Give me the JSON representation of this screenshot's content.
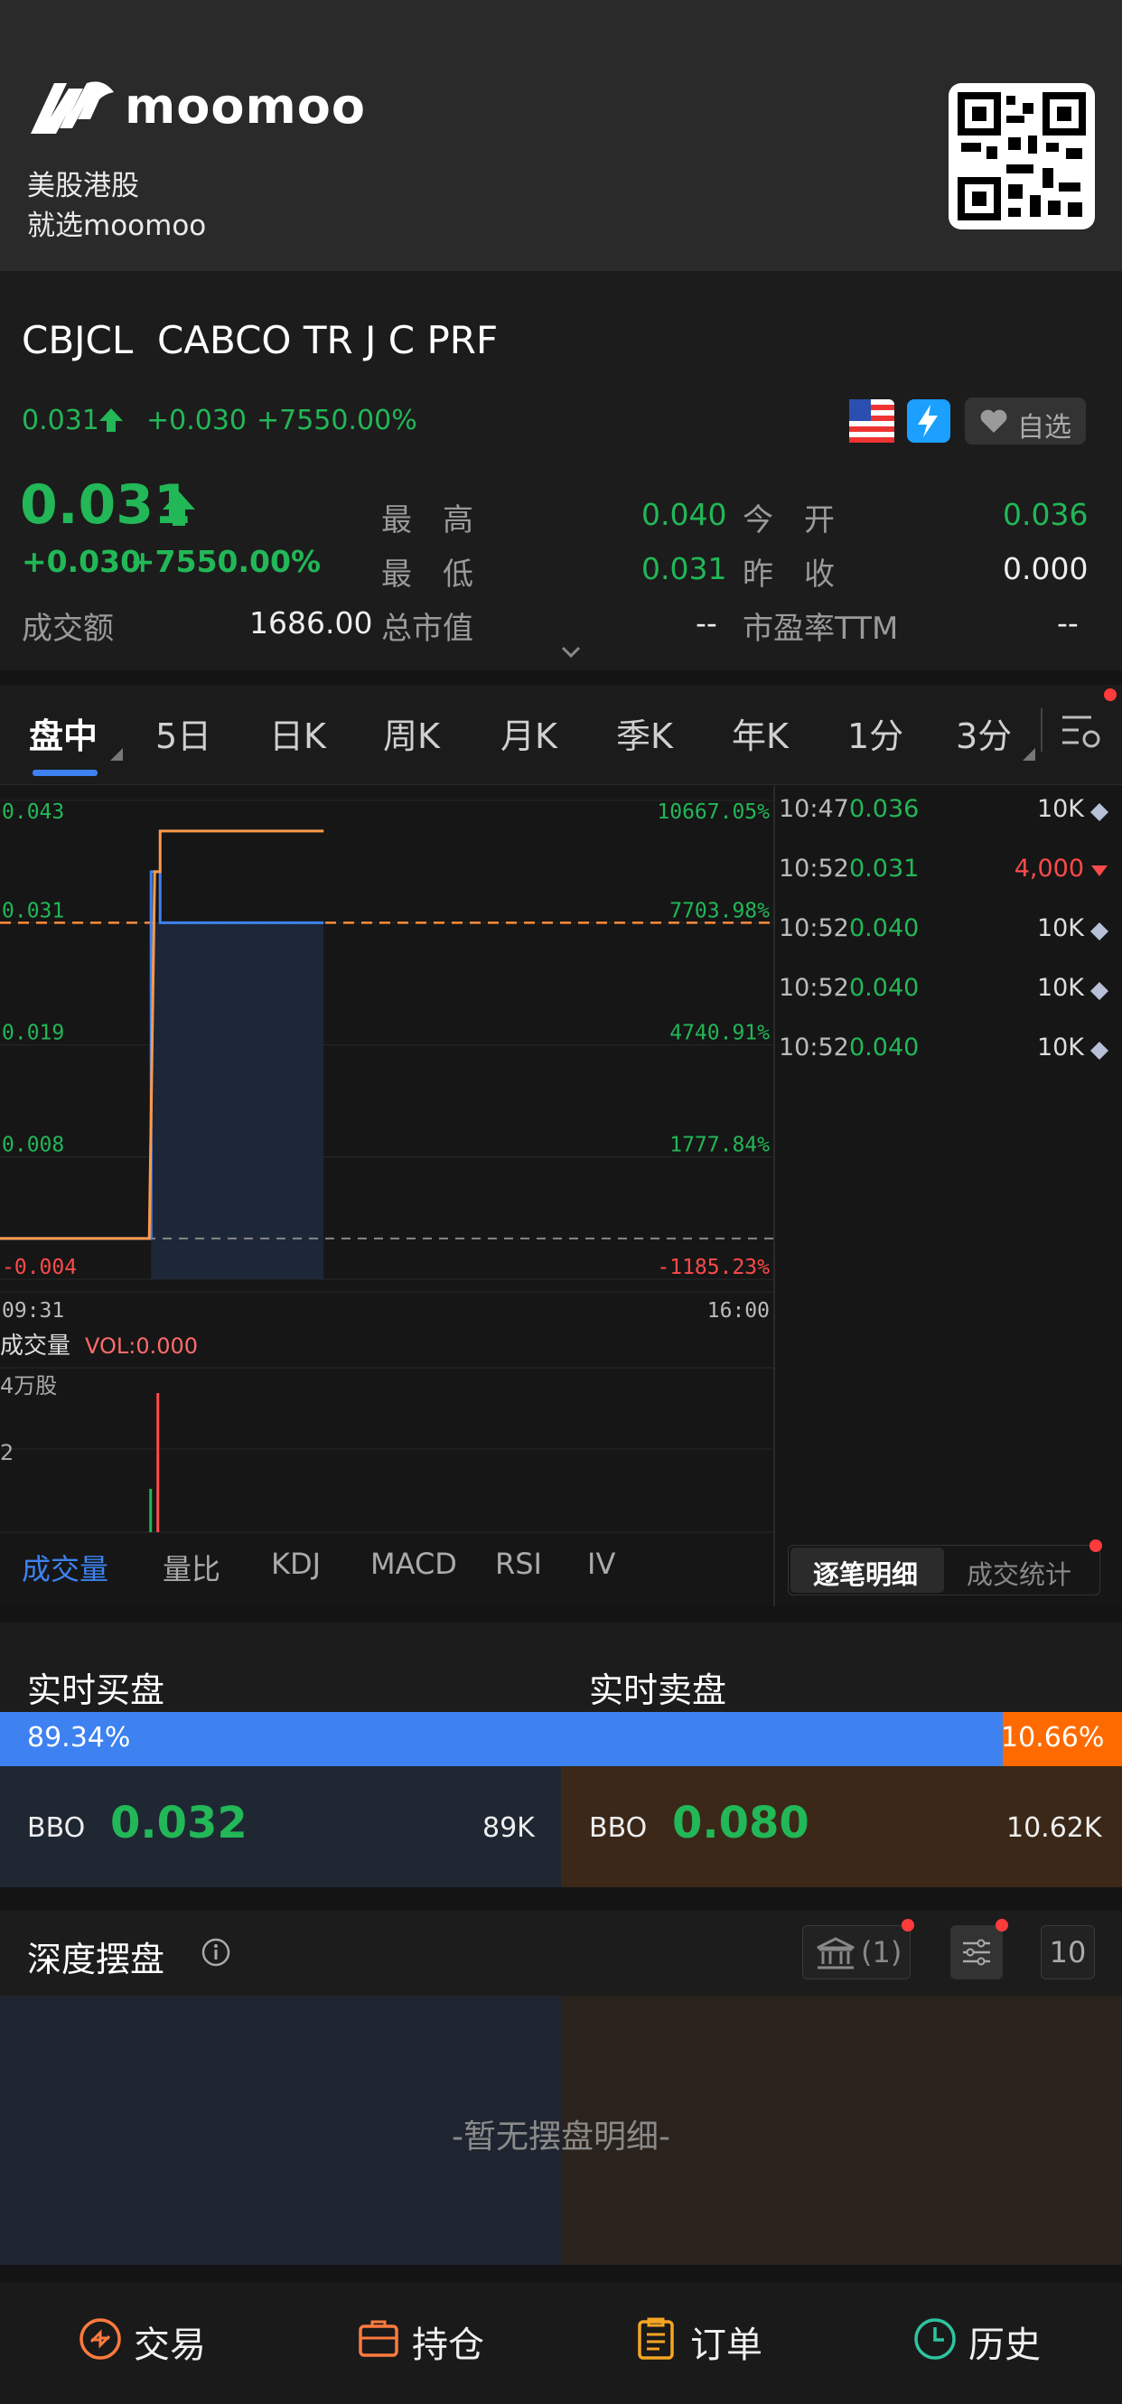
{
  "banner": {
    "brand": "moomoo",
    "slogan1": "美股港股",
    "slogan2": "就选moomoo"
  },
  "stock": {
    "code": "CBJCL",
    "name": "CABCO TR J C PRF",
    "mini_price": "0.031",
    "mini_change": "+0.030",
    "mini_pct": "+7550.00%",
    "watch_label": "自选",
    "price": "0.031",
    "change": "+0.030",
    "pct": "+7550.00%",
    "turnover_label": "成交额",
    "turnover": "1686.00",
    "high_label": "最　高",
    "high": "0.040",
    "low_label": "最　低",
    "low": "0.031",
    "mcap_label": "总市值",
    "mcap": "--",
    "open_label": "今　开",
    "open": "0.036",
    "prev_label": "昨　收",
    "prev": "0.000",
    "pe_label": "市盈率TTM",
    "pe": "--"
  },
  "tabs": [
    "盘中",
    "5日",
    "日K",
    "周K",
    "月K",
    "季K",
    "年K",
    "1分",
    "3分"
  ],
  "chart_data": {
    "type": "line",
    "title": "",
    "x": [
      "09:31",
      "10:47",
      "10:52",
      "16:00"
    ],
    "x_range": [
      "09:31",
      "16:00"
    ],
    "y_ticks_left": [
      "0.043",
      "0.031",
      "0.019",
      "0.008",
      "-0.004"
    ],
    "y_ticks_right": [
      "10667.05%",
      "7703.98%",
      "4740.91%",
      "1777.84%",
      "-1185.23%"
    ],
    "ylim": [
      -0.004,
      0.043
    ],
    "series": [
      {
        "values": [
          0.0,
          0.036,
          0.04
        ]
      },
      {
        "values": [
          0.0,
          0.036,
          0.031
        ]
      }
    ],
    "ref_line_price": 0.031,
    "prev_close": 0.0,
    "grid": true
  },
  "volume": {
    "label": "成交量",
    "vol": "VOL:0.000",
    "unit": "4万股",
    "tick": "2"
  },
  "indicators": [
    "成交量",
    "量比",
    "KDJ",
    "MACD",
    "RSI",
    "IV"
  ],
  "ticks": [
    {
      "time": "10:47",
      "price": "0.036",
      "vol": "10K",
      "dir": "neutral"
    },
    {
      "time": "10:52",
      "price": "0.031",
      "vol": "4,000",
      "dir": "down"
    },
    {
      "time": "10:52",
      "price": "0.040",
      "vol": "10K",
      "dir": "neutral"
    },
    {
      "time": "10:52",
      "price": "0.040",
      "vol": "10K",
      "dir": "neutral"
    },
    {
      "time": "10:52",
      "price": "0.040",
      "vol": "10K",
      "dir": "neutral"
    }
  ],
  "tick_tabs": [
    "逐笔明细",
    "成交统计"
  ],
  "orderbook": {
    "bid_title": "实时买盘",
    "ask_title": "实时卖盘",
    "bid_pct": "89.34%",
    "ask_pct": "10.66%",
    "bid_ratio": 0.8934,
    "bid_label": "BBO",
    "bid_price": "0.032",
    "bid_size": "89K",
    "ask_label": "BBO",
    "ask_price": "0.080",
    "ask_size": "10.62K"
  },
  "depth": {
    "title": "深度摆盘",
    "broker": "(1)",
    "levels": "10",
    "empty": "-暂无摆盘明细-"
  },
  "bottom_nav": [
    "交易",
    "持仓",
    "订单",
    "历史"
  ]
}
